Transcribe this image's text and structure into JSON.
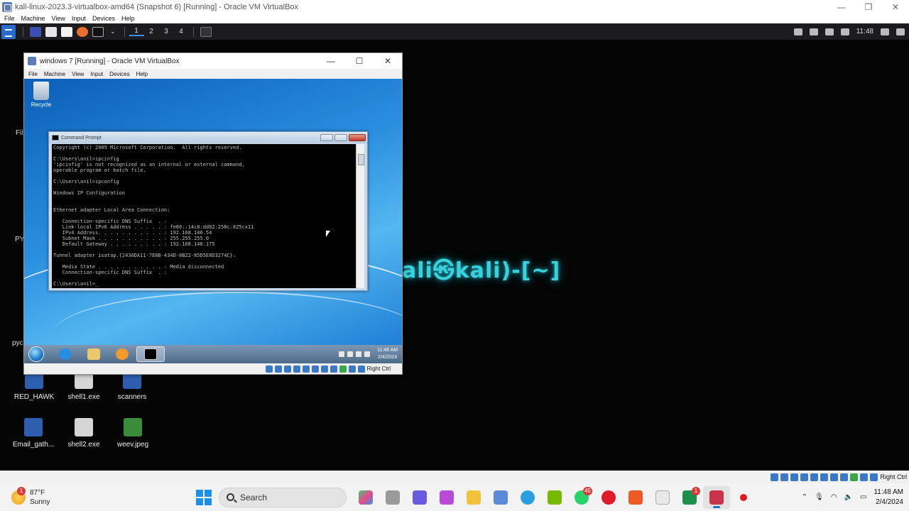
{
  "host_window": {
    "title": "kali-linux-2023.3-virtualbox-amd64 (Snapshot 6) [Running] - Oracle VM VirtualBox",
    "controls": [
      "—",
      "❐",
      "✕"
    ],
    "menu": [
      "File",
      "Machine",
      "View",
      "Input",
      "Devices",
      "Help"
    ],
    "status_right": "Right Ctrl"
  },
  "kali_panel": {
    "workspaces": [
      "1",
      "2",
      "3",
      "4"
    ],
    "clock": "11:48"
  },
  "kali_desktop": {
    "logo_text": "ali㉿kali)-[~]",
    "edge_labels": [
      "Fil",
      "PY",
      "pyc"
    ],
    "icons": [
      {
        "label": "RED_HAWK",
        "color": "#2d5fb0"
      },
      {
        "label": "shell1.exe",
        "color": "#d6d6d6"
      },
      {
        "label": "scanners",
        "color": "#2d5fb0"
      },
      {
        "label": "Email_gath...",
        "color": "#2d5fb0"
      },
      {
        "label": "shell2.exe",
        "color": "#d6d6d6"
      },
      {
        "label": "weev.jpeg",
        "color": "#3a8b3a"
      }
    ]
  },
  "guest_window": {
    "title": "windows 7 [Running] - Oracle VM VirtualBox",
    "controls": [
      "—",
      "☐",
      "✕"
    ],
    "menu": [
      "File",
      "Machine",
      "View",
      "Input",
      "Devices",
      "Help"
    ],
    "recycle_label": "Recycle",
    "status_right": "Right Ctrl"
  },
  "cmd": {
    "title": "Command Prompt",
    "lines": [
      "Copyright (c) 2009 Microsoft Corporation.  All rights reserved.",
      "",
      "C:\\Users\\anil>ipcinfig",
      "'ipcinfig' is not recognized as an internal or external command,",
      "operable program or batch file.",
      "",
      "C:\\Users\\anil>ipconfig",
      "",
      "Windows IP Configuration",
      "",
      "",
      "Ethernet adapter Local Area Connection:",
      "",
      "   Connection-specific DNS Suffix  . :",
      "   Link-local IPv6 Address . . . . . : fe80::14c8:dd02:258c:825cx11",
      "   IPv4 Address. . . . . . . . . . . : 192.168.146.54",
      "   Subnet Mask . . . . . . . . . . . : 255.255.255.0",
      "   Default Gateway . . . . . . . . . : 192.168.146.175",
      "",
      "Tunnel adapter isatap.{2436DA11-7E0B-434D-8B22-85D5E8D3274C}:",
      "",
      "   Media State . . . . . . . . . . . : Media disconnected",
      "   Connection-specific DNS Suffix  . :",
      "",
      "C:\\Users\\anil>_"
    ]
  },
  "win7_taskbar": {
    "time": "11:48 AM",
    "date": "2/4/2024"
  },
  "win11_taskbar": {
    "weather_temp": "87°F",
    "weather_desc": "Sunny",
    "weather_badge": "1",
    "search_label": "Search",
    "whatsapp_badge": "45",
    "app_badge": "1",
    "time": "11:48 AM",
    "date": "2/4/2024"
  }
}
